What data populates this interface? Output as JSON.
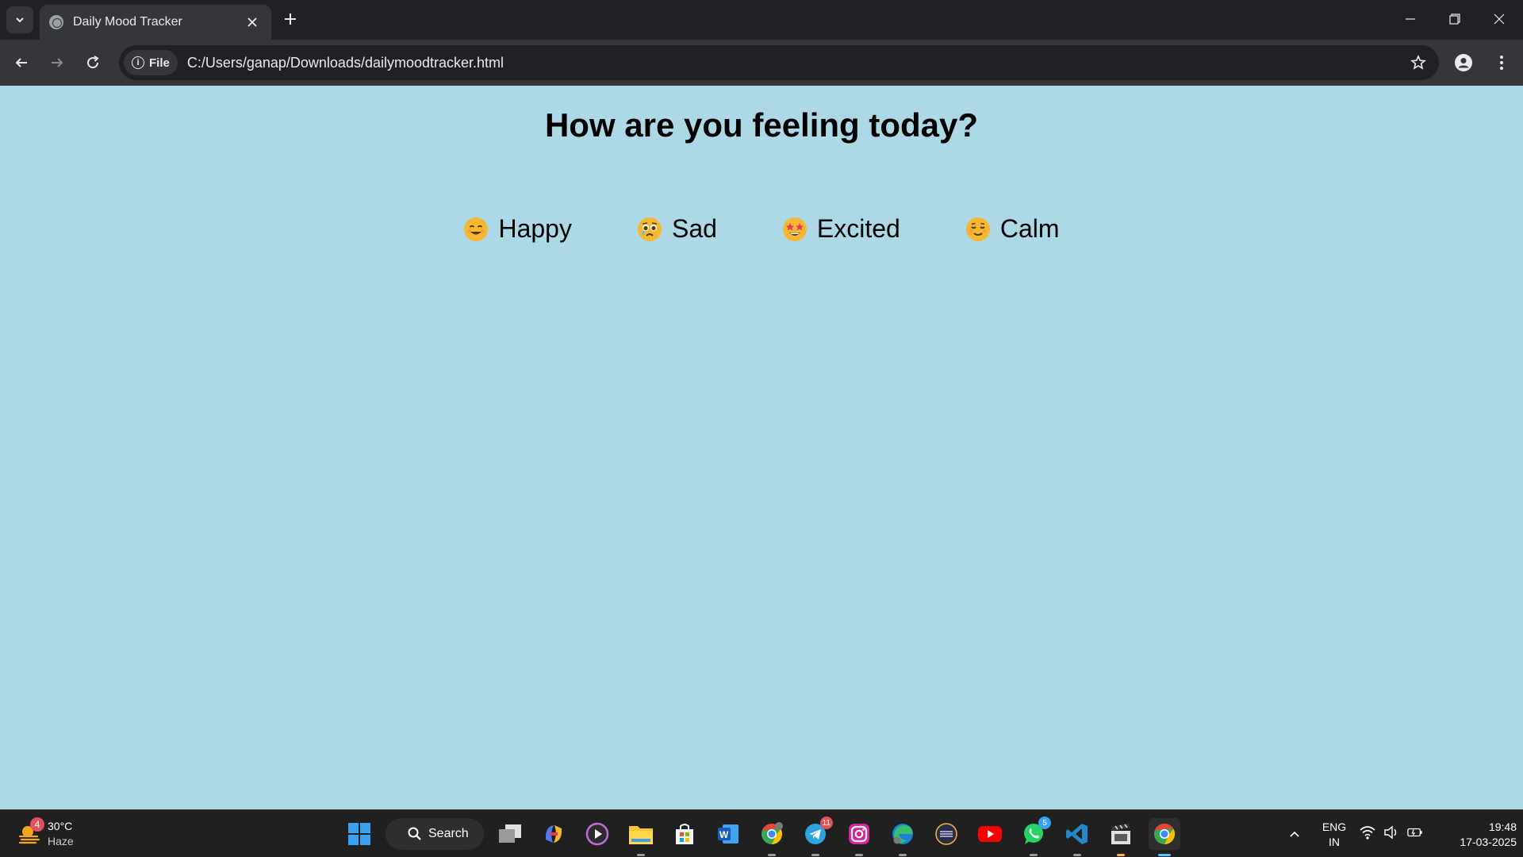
{
  "browser": {
    "tab_title": "Daily Mood Tracker",
    "site_chip_label": "File",
    "url": "C:/Users/ganap/Downloads/dailymoodtracker.html"
  },
  "page": {
    "title": "How are you feeling today?",
    "background_color": "#add8e6",
    "moods": [
      {
        "label": "Happy",
        "emoji": "smiling-face-icon"
      },
      {
        "label": "Sad",
        "emoji": "tearful-face-icon"
      },
      {
        "label": "Excited",
        "emoji": "star-struck-face-icon"
      },
      {
        "label": "Calm",
        "emoji": "relieved-face-icon"
      }
    ]
  },
  "taskbar": {
    "weather": {
      "temperature": "30°C",
      "condition": "Haze",
      "badge": "4"
    },
    "search_label": "Search",
    "badges": {
      "telegram": "11",
      "whatsapp": "5"
    },
    "language": {
      "line1": "ENG",
      "line2": "IN"
    },
    "clock": {
      "time": "19:48",
      "date": "17-03-2025"
    }
  }
}
